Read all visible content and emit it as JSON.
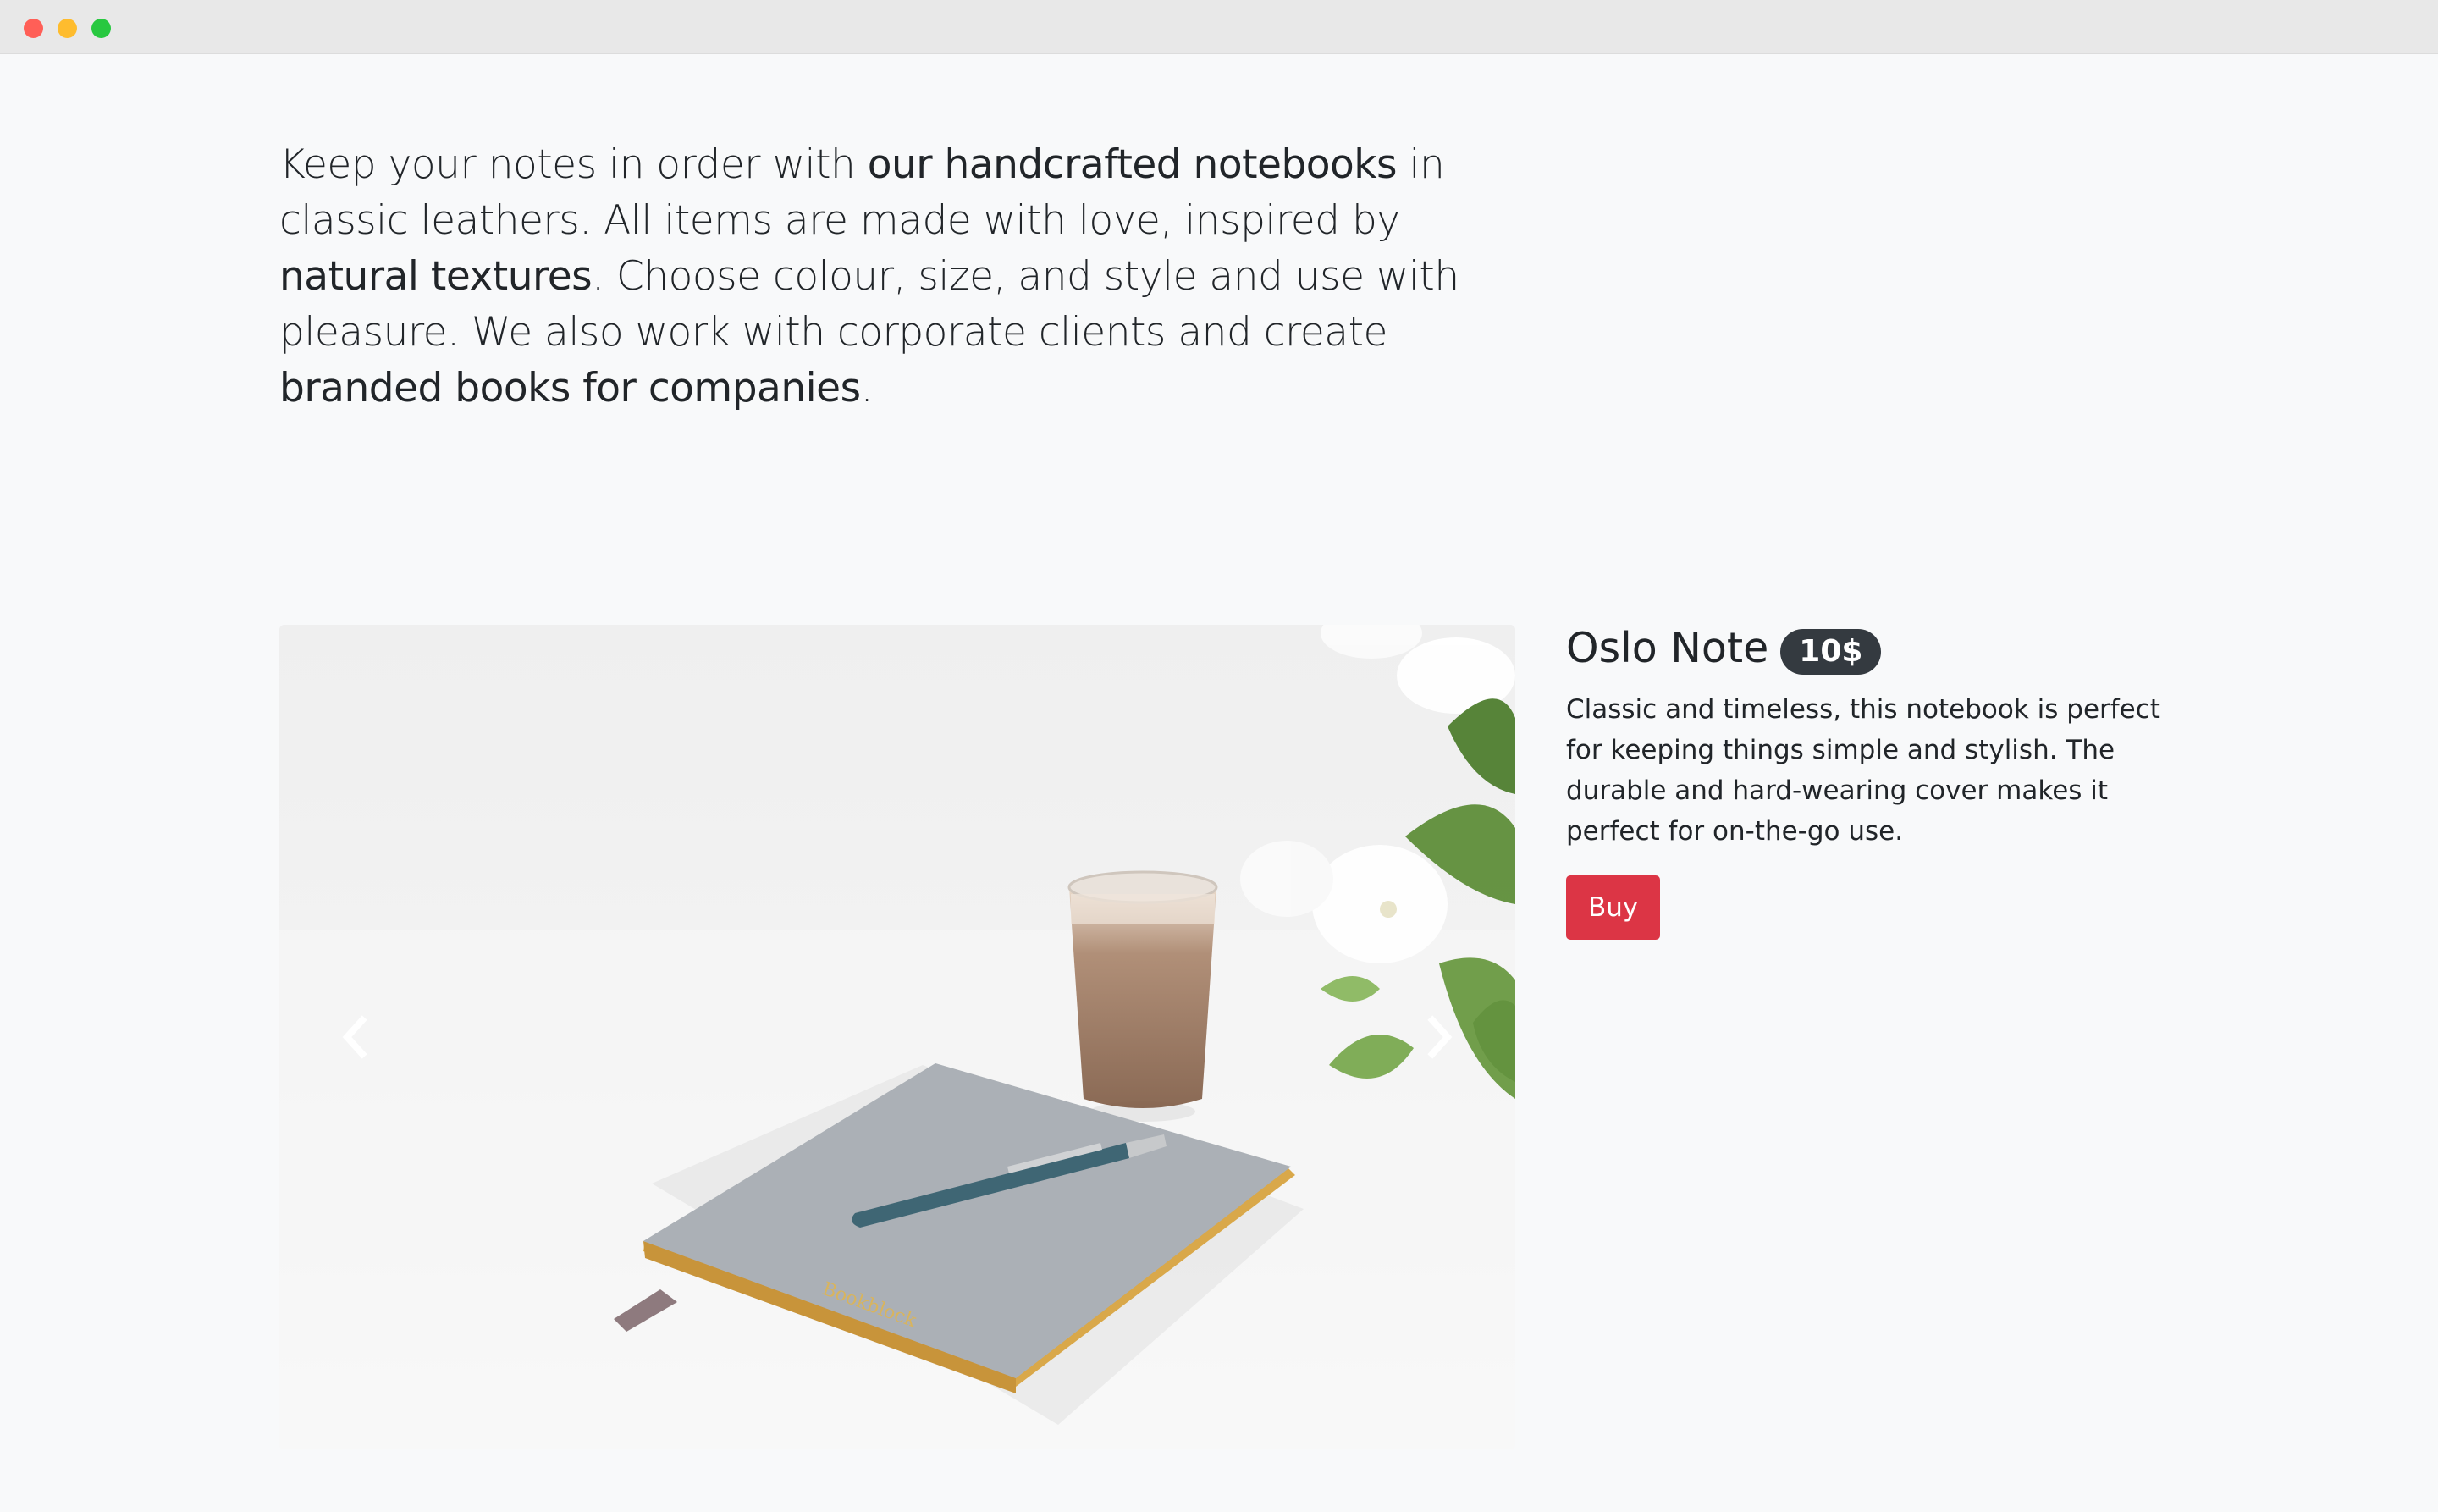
{
  "intro": {
    "parts": [
      {
        "text": "Keep your notes in order with ",
        "bold": false
      },
      {
        "text": "our handcrafted notebooks",
        "bold": true
      },
      {
        "text": " in classic leathers. All items are made with love, inspired by ",
        "bold": false
      },
      {
        "text": "natural textures",
        "bold": true
      },
      {
        "text": ". Choose colour, size, and style and use with pleasure. We also work with corporate clients and create ",
        "bold": false
      },
      {
        "text": "branded books for companies",
        "bold": true
      },
      {
        "text": ".",
        "bold": false
      }
    ]
  },
  "carousel": {
    "prev_icon": "chevron-left-icon",
    "next_icon": "chevron-right-icon",
    "cover_text": "Bookblock"
  },
  "product": {
    "title": "Oslo Note",
    "price": "10$",
    "description": "Classic and timeless, this notebook is perfect for keeping things simple and stylish. The durable and hard-wearing cover makes it perfect for on-the-go use.",
    "buy_label": "Buy"
  },
  "colors": {
    "page_bg": "#f8f9fa",
    "badge_bg": "#343a40",
    "buy_bg": "#dc3545"
  }
}
